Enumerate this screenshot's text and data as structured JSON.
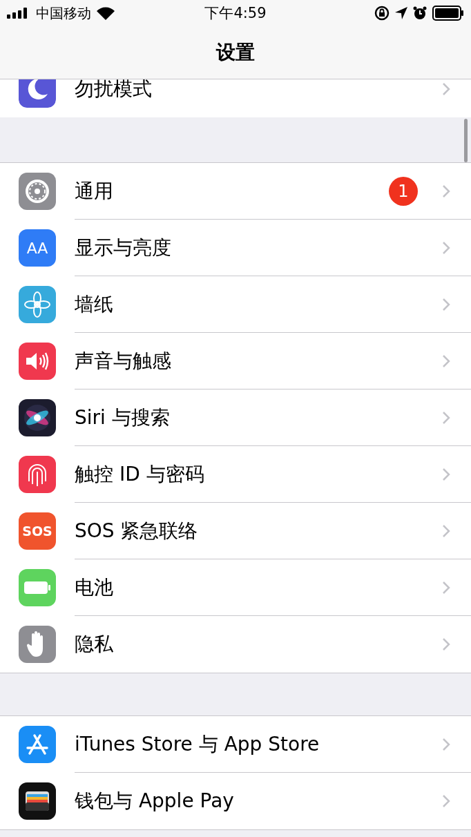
{
  "status_bar": {
    "carrier": "中国移动",
    "time": "下午4:59"
  },
  "nav": {
    "title": "设置"
  },
  "top_row": {
    "label": "勿扰模式",
    "kind": "moon"
  },
  "groups": [
    {
      "items": [
        {
          "label": "通用",
          "kind": "gear",
          "badge": "1"
        },
        {
          "label": "显示与亮度",
          "kind": "display",
          "icon_text": "AA"
        },
        {
          "label": "墙纸",
          "kind": "flower"
        },
        {
          "label": "声音与触感",
          "kind": "speaker"
        },
        {
          "label": "Siri 与搜索",
          "kind": "siri"
        },
        {
          "label": "触控 ID 与密码",
          "kind": "fingerprint"
        },
        {
          "label": "SOS 紧急联络",
          "kind": "sos",
          "icon_text": "SOS"
        },
        {
          "label": "电池",
          "kind": "battery"
        },
        {
          "label": "隐私",
          "kind": "hand"
        }
      ]
    },
    {
      "items": [
        {
          "label": "iTunes Store 与 App Store",
          "kind": "appstore"
        },
        {
          "label": "钱包与 Apple Pay",
          "kind": "wallet"
        }
      ]
    }
  ]
}
